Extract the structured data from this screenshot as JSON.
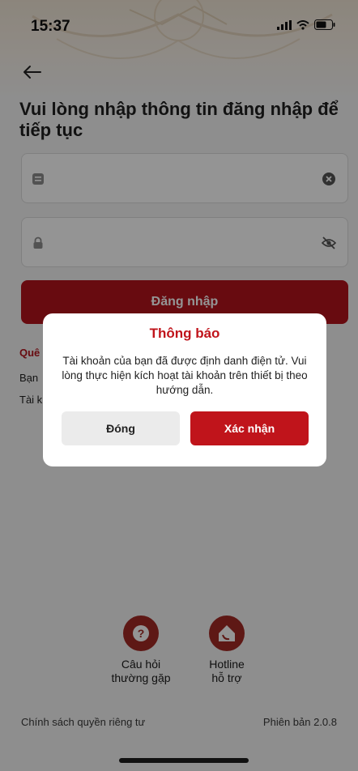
{
  "status": {
    "time": "15:37",
    "icons": [
      "signal-icon",
      "wifi-icon",
      "battery-icon"
    ]
  },
  "header": {
    "title_line1": "Vui lòng nhập thông tin đăng nhập để",
    "title_line2": "tiếp tục"
  },
  "form": {
    "username_icon": "id-card-icon",
    "username_value": "",
    "clear_icon": "clear-circle-icon",
    "password_icon": "lock-icon",
    "password_value": "",
    "visibility_icon": "eye-off-icon",
    "login_label": "Đăng nhập"
  },
  "behind": {
    "line1": "Quê",
    "line2": "Bạn",
    "line3": "Tài k"
  },
  "dialog": {
    "title": "Thông báo",
    "message": "Tài khoản của bạn đã được định danh điện tử. Vui lòng thực hiện kích hoạt tài khoản trên thiết bị theo hướng dẫn.",
    "close_label": "Đóng",
    "confirm_label": "Xác nhận"
  },
  "shortcuts": [
    {
      "icon": "question-circle-icon",
      "line1": "Câu hỏi",
      "line2": "thường gặp"
    },
    {
      "icon": "hotline-icon",
      "line1": "Hotline",
      "line2": "hỗ trợ"
    }
  ],
  "footer": {
    "privacy": "Chính sách quyền riêng tư",
    "version": "Phiên bản 2.0.8"
  },
  "colors": {
    "brand_red": "#b4141d",
    "dialog_red": "#c0141b",
    "shortcut_red": "#a32a25"
  }
}
